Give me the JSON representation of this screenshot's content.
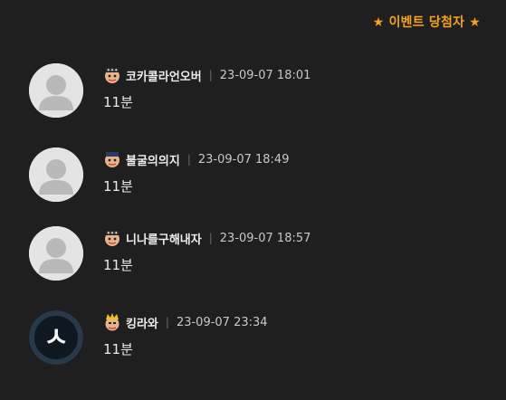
{
  "event_banner": "★ 이벤트 당첨자 ★",
  "comments": [
    {
      "nickname": "코카콜라언오버",
      "separator": "|",
      "time": "23-09-07 18:01",
      "text": "11분",
      "avatar": "default-avatar",
      "badge": "level-badge"
    },
    {
      "nickname": "불굴의의지",
      "separator": "|",
      "time": "23-09-07 18:49",
      "text": "11분",
      "avatar": "default-avatar",
      "badge": "level-badge"
    },
    {
      "nickname": "니나를구해내자",
      "separator": "|",
      "time": "23-09-07 18:57",
      "text": "11분",
      "avatar": "default-avatar",
      "badge": "level-badge"
    },
    {
      "nickname": "킹라와",
      "separator": "|",
      "time": "23-09-07 23:34",
      "text": "11분",
      "avatar": "custom-avatar",
      "avatar_glyph": "ㅅ",
      "badge": "crown-badge"
    }
  ],
  "colors": {
    "background": "#1f1f1f",
    "accent": "#f5a31a",
    "text": "#e9e9e9",
    "muted": "#c8c8c8"
  }
}
